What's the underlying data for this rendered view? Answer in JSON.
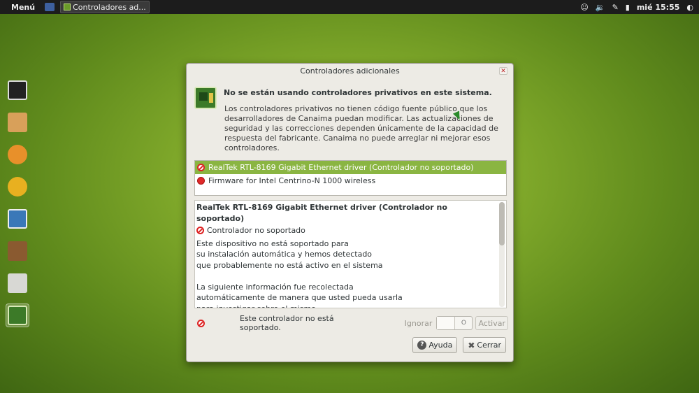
{
  "panel": {
    "menu_label": "Menú",
    "task_label": "Controladores ad...",
    "clock": "mié 15:55",
    "tray_icons": [
      "accessibility-icon",
      "volume-icon",
      "network-icon",
      "battery-icon"
    ]
  },
  "dock": {
    "items": [
      "monitor-icon",
      "home-folder-icon",
      "firefox-icon",
      "thunderbird-icon",
      "writer-icon",
      "speaker-icon",
      "trash-icon",
      "drivers-icon"
    ],
    "active_index": 7
  },
  "dialog": {
    "title": "Controladores adicionales",
    "header_title": "No se están usando controladores privativos en este sistema.",
    "description": "Los controladores privativos no tienen código fuente público que los desarrolladores de Canaima puedan modificar. Las actualizaciones de seguridad y las correcciones dependen únicamente de la capacidad de respuesta del fabricante. Canaima no puede arreglar ni mejorar esos controladores.",
    "drivers": [
      {
        "label": "RealTek RTL-8169 Gigabit Ethernet driver (Controlador no soportado)",
        "state": "unsupported",
        "selected": true
      },
      {
        "label": "Firmware for Intel Centrino-N 1000 wireless",
        "state": "inactive",
        "selected": false
      }
    ],
    "details": {
      "title": "RealTek RTL-8169 Gigabit Ethernet driver (Controlador no soportado)",
      "status": "Controlador no soportado",
      "body": "Este dispositivo no está soportado para\nsu instalación automática y hemos detectado\nque probablemente no está activo en el sistema\n\nLa siguiente información fue recolectada\nautomáticamente de manera que usted pueda usarla\npara investigar sobre el mismo\n       Type: pci"
    },
    "status_text": "Este controlador no está soportado.",
    "ignore_label": "Ignorar",
    "toggle_off_glyph": "O",
    "activate_label": "Activar",
    "help_label": "Ayuda",
    "close_label": "Cerrar"
  },
  "colors": {
    "selection": "#8ab542",
    "panel": "#1c1c1c",
    "error_red": "#dd2222"
  }
}
